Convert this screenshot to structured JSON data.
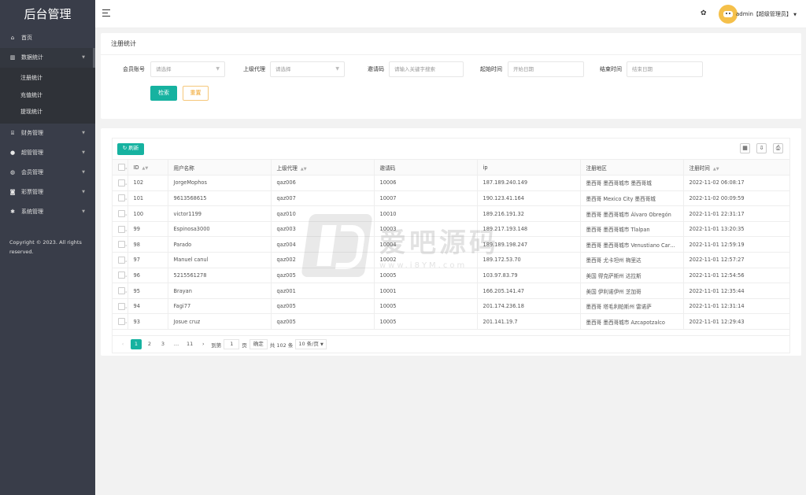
{
  "app": {
    "title": "后台管理",
    "copyright": "Copyright © 2023. All rights reserved."
  },
  "sidebar": {
    "items": [
      {
        "label": "首页",
        "icon": "home-icon",
        "glyph": "⌂"
      },
      {
        "label": "数据统计",
        "icon": "bar-chart-icon",
        "glyph": "▥",
        "open": true,
        "children": [
          "注册统计",
          "充值统计",
          "提现统计"
        ]
      },
      {
        "label": "财务管理",
        "icon": "bank-icon",
        "glyph": "⌸"
      },
      {
        "label": "超管管理",
        "icon": "user-icon",
        "glyph": "●"
      },
      {
        "label": "会员管理",
        "icon": "users-icon",
        "glyph": "◍"
      },
      {
        "label": "彩票管理",
        "icon": "gamepad-icon",
        "glyph": "◙"
      },
      {
        "label": "系统管理",
        "icon": "gear-icon",
        "glyph": "✱"
      }
    ]
  },
  "topbar": {
    "user": "admin【超级管理员】"
  },
  "filter": {
    "title": "注册统计",
    "member_label": "会员账号",
    "member_placeholder": "请选择",
    "agent_label": "上级代理",
    "agent_placeholder": "请选择",
    "invite_label": "邀请码",
    "invite_placeholder": "请输入关键字搜索",
    "start_label": "起始时间",
    "start_placeholder": "开始日期",
    "end_label": "结束时间",
    "end_placeholder": "结束日期",
    "search_btn": "检索",
    "reset_btn": "重置"
  },
  "table": {
    "refresh": "刷新",
    "columns": [
      "ID",
      "用户名称",
      "上级代理",
      "邀请码",
      "ip",
      "注册地区",
      "注册时间"
    ],
    "rows": [
      [
        "102",
        "JorgeMophos",
        "qaz006",
        "10006",
        "187.189.240.149",
        "墨西哥 墨西哥城市 墨西哥城",
        "2022-11-02 06:08:17"
      ],
      [
        "101",
        "9613568615",
        "qaz007",
        "10007",
        "190.123.41.164",
        "墨西哥 Mexico City 墨西哥城",
        "2022-11-02 00:09:59"
      ],
      [
        "100",
        "victor1199",
        "qaz010",
        "10010",
        "189.216.191.32",
        "墨西哥 墨西哥城市 Álvaro Obregón",
        "2022-11-01 22:31:17"
      ],
      [
        "99",
        "Espinosa3000",
        "qaz003",
        "10003",
        "189.217.193.148",
        "墨西哥 墨西哥城市 Tlalpan",
        "2022-11-01 13:20:35"
      ],
      [
        "98",
        "Parado",
        "qaz004",
        "10004",
        "189.189.198.247",
        "墨西哥 墨西哥城市 Venustiano Carranza",
        "2022-11-01 12:59:19"
      ],
      [
        "97",
        "Manuel canul",
        "qaz002",
        "10002",
        "189.172.53.70",
        "墨西哥 尤卡坦州 梅里达",
        "2022-11-01 12:57:27"
      ],
      [
        "96",
        "5215561278",
        "qaz005",
        "10005",
        "103.97.83.79",
        "美国 得克萨斯州 达拉斯",
        "2022-11-01 12:54:56"
      ],
      [
        "95",
        "Brayan",
        "qaz001",
        "10001",
        "166.205.141.47",
        "美国 伊利诺伊州 芝加哥",
        "2022-11-01 12:35:44"
      ],
      [
        "94",
        "Fagi77",
        "qaz005",
        "10005",
        "201.174.236.18",
        "墨西哥 塔毛利帕斯州 雷诺萨",
        "2022-11-01 12:31:14"
      ],
      [
        "93",
        "Josue cruz",
        "qaz005",
        "10005",
        "201.141.19.7",
        "墨西哥 墨西哥城市 Azcapotzalco",
        "2022-11-01 12:29:43"
      ]
    ]
  },
  "pager": {
    "prev": "‹",
    "p1": "1",
    "p2": "2",
    "p3": "3",
    "ellipsis": "…",
    "last": "11",
    "next": "›",
    "goto": "到第",
    "page_input": "1",
    "page_unit": "页",
    "confirm": "确定",
    "total": "共 102 条",
    "per_page": "10 条/页"
  },
  "watermark": {
    "cn": "爱吧源码",
    "url": "www.i8YM.com"
  },
  "colors": {
    "accent": "#16b2a0",
    "sidebar": "#393d49",
    "reset_border": "#f5c77a"
  }
}
